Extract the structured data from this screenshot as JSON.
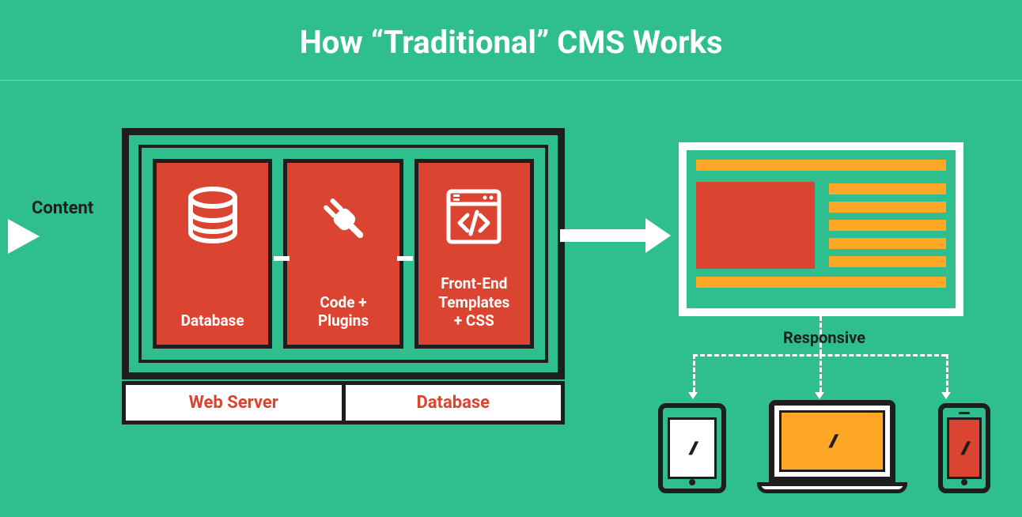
{
  "title": "How “Traditional” CMS Works",
  "input_label": "Content",
  "cards": [
    {
      "label": "Database"
    },
    {
      "label": "Code +\nPlugins"
    },
    {
      "label": "Front-End\nTemplates\n+ CSS"
    }
  ],
  "footer": {
    "left": "Web Server",
    "right": "Database"
  },
  "responsive_label": "Responsive",
  "icons": {
    "database": "database-icon",
    "plug": "plug-icon",
    "template": "template-code-icon",
    "tablet": "tablet-icon",
    "laptop": "laptop-icon",
    "phone": "smartphone-icon"
  },
  "colors": {
    "background": "#2fbf8f",
    "card": "#da4431",
    "accent": "#ffa726",
    "ink": "#1e1e1e",
    "white": "#ffffff"
  }
}
